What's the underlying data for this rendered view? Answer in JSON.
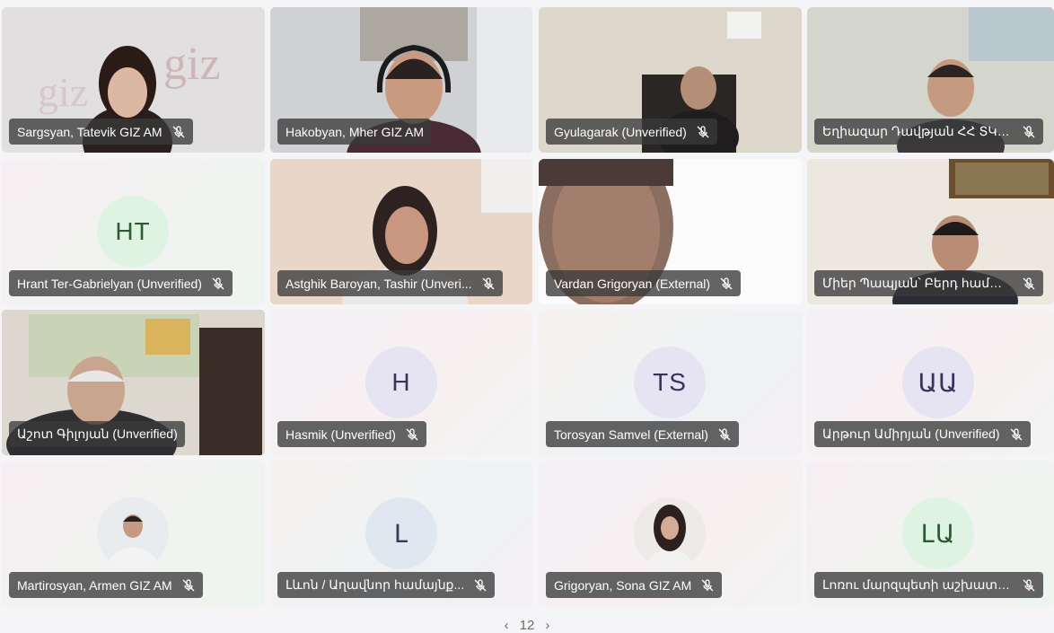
{
  "participants": [
    {
      "name": "Sargsyan, Tatevik GIZ AM"
    },
    {
      "name": "Hakobyan, Mher GIZ AM"
    },
    {
      "name": "Gyulagarak (Unverified)"
    },
    {
      "name": "Եղիազար Դավթյան ՀՀ ՏԿԵ..."
    },
    {
      "name": "Hrant Ter-Gabrielyan (Unverified)",
      "initials": "HT"
    },
    {
      "name": "Astghik Baroyan, Tashir (Unveri..."
    },
    {
      "name": "Vardan Grigoryan (External)"
    },
    {
      "name": "Միեր Պապյան՝ Բերդ համայն..."
    },
    {
      "name": "Աշոտ Գիլոյան (Unverified)"
    },
    {
      "name": "Hasmik (Unverified)",
      "initials": "H"
    },
    {
      "name": "Torosyan Samvel (External)",
      "initials": "TS"
    },
    {
      "name": "Արթուր Ամիրյան (Unverified)",
      "initials": "ԱԱ"
    },
    {
      "name": "Martirosyan, Armen GIZ AM"
    },
    {
      "name": "Լևոն / Աղավնոր համայնք...",
      "initials": "Լ"
    },
    {
      "name": "Grigoryan, Sona GIZ AM"
    },
    {
      "name": "Լոռու մարզպետի աշխատակ...",
      "initials": "ԼԱ"
    }
  ],
  "pager": {
    "label": "12"
  },
  "colors": {
    "active_border": "#5b5fc7",
    "nameplate": "#3a3a3a"
  },
  "icons": {
    "nameplate_status": "mic-off-icon"
  }
}
